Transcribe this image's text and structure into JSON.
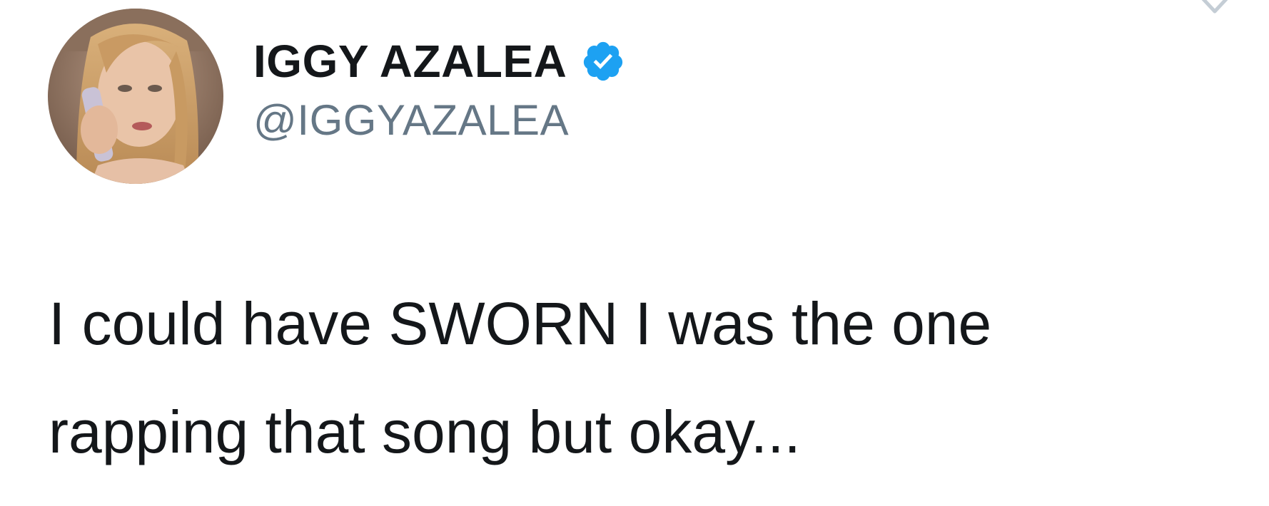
{
  "author": {
    "display_name": "IGGY AZALEA",
    "handle": "@IGGYAZALEA",
    "verified": true,
    "verified_badge_color": "#1da1f2"
  },
  "avatar": {
    "icon": "user-avatar-photo"
  },
  "menu": {
    "icon": "chevron-down-icon"
  },
  "tweet": {
    "text": "I could have SWORN I was the one\nrapping that song but okay..."
  },
  "colors": {
    "text": "#14171a",
    "handle": "#657786",
    "background": "#ffffff"
  }
}
